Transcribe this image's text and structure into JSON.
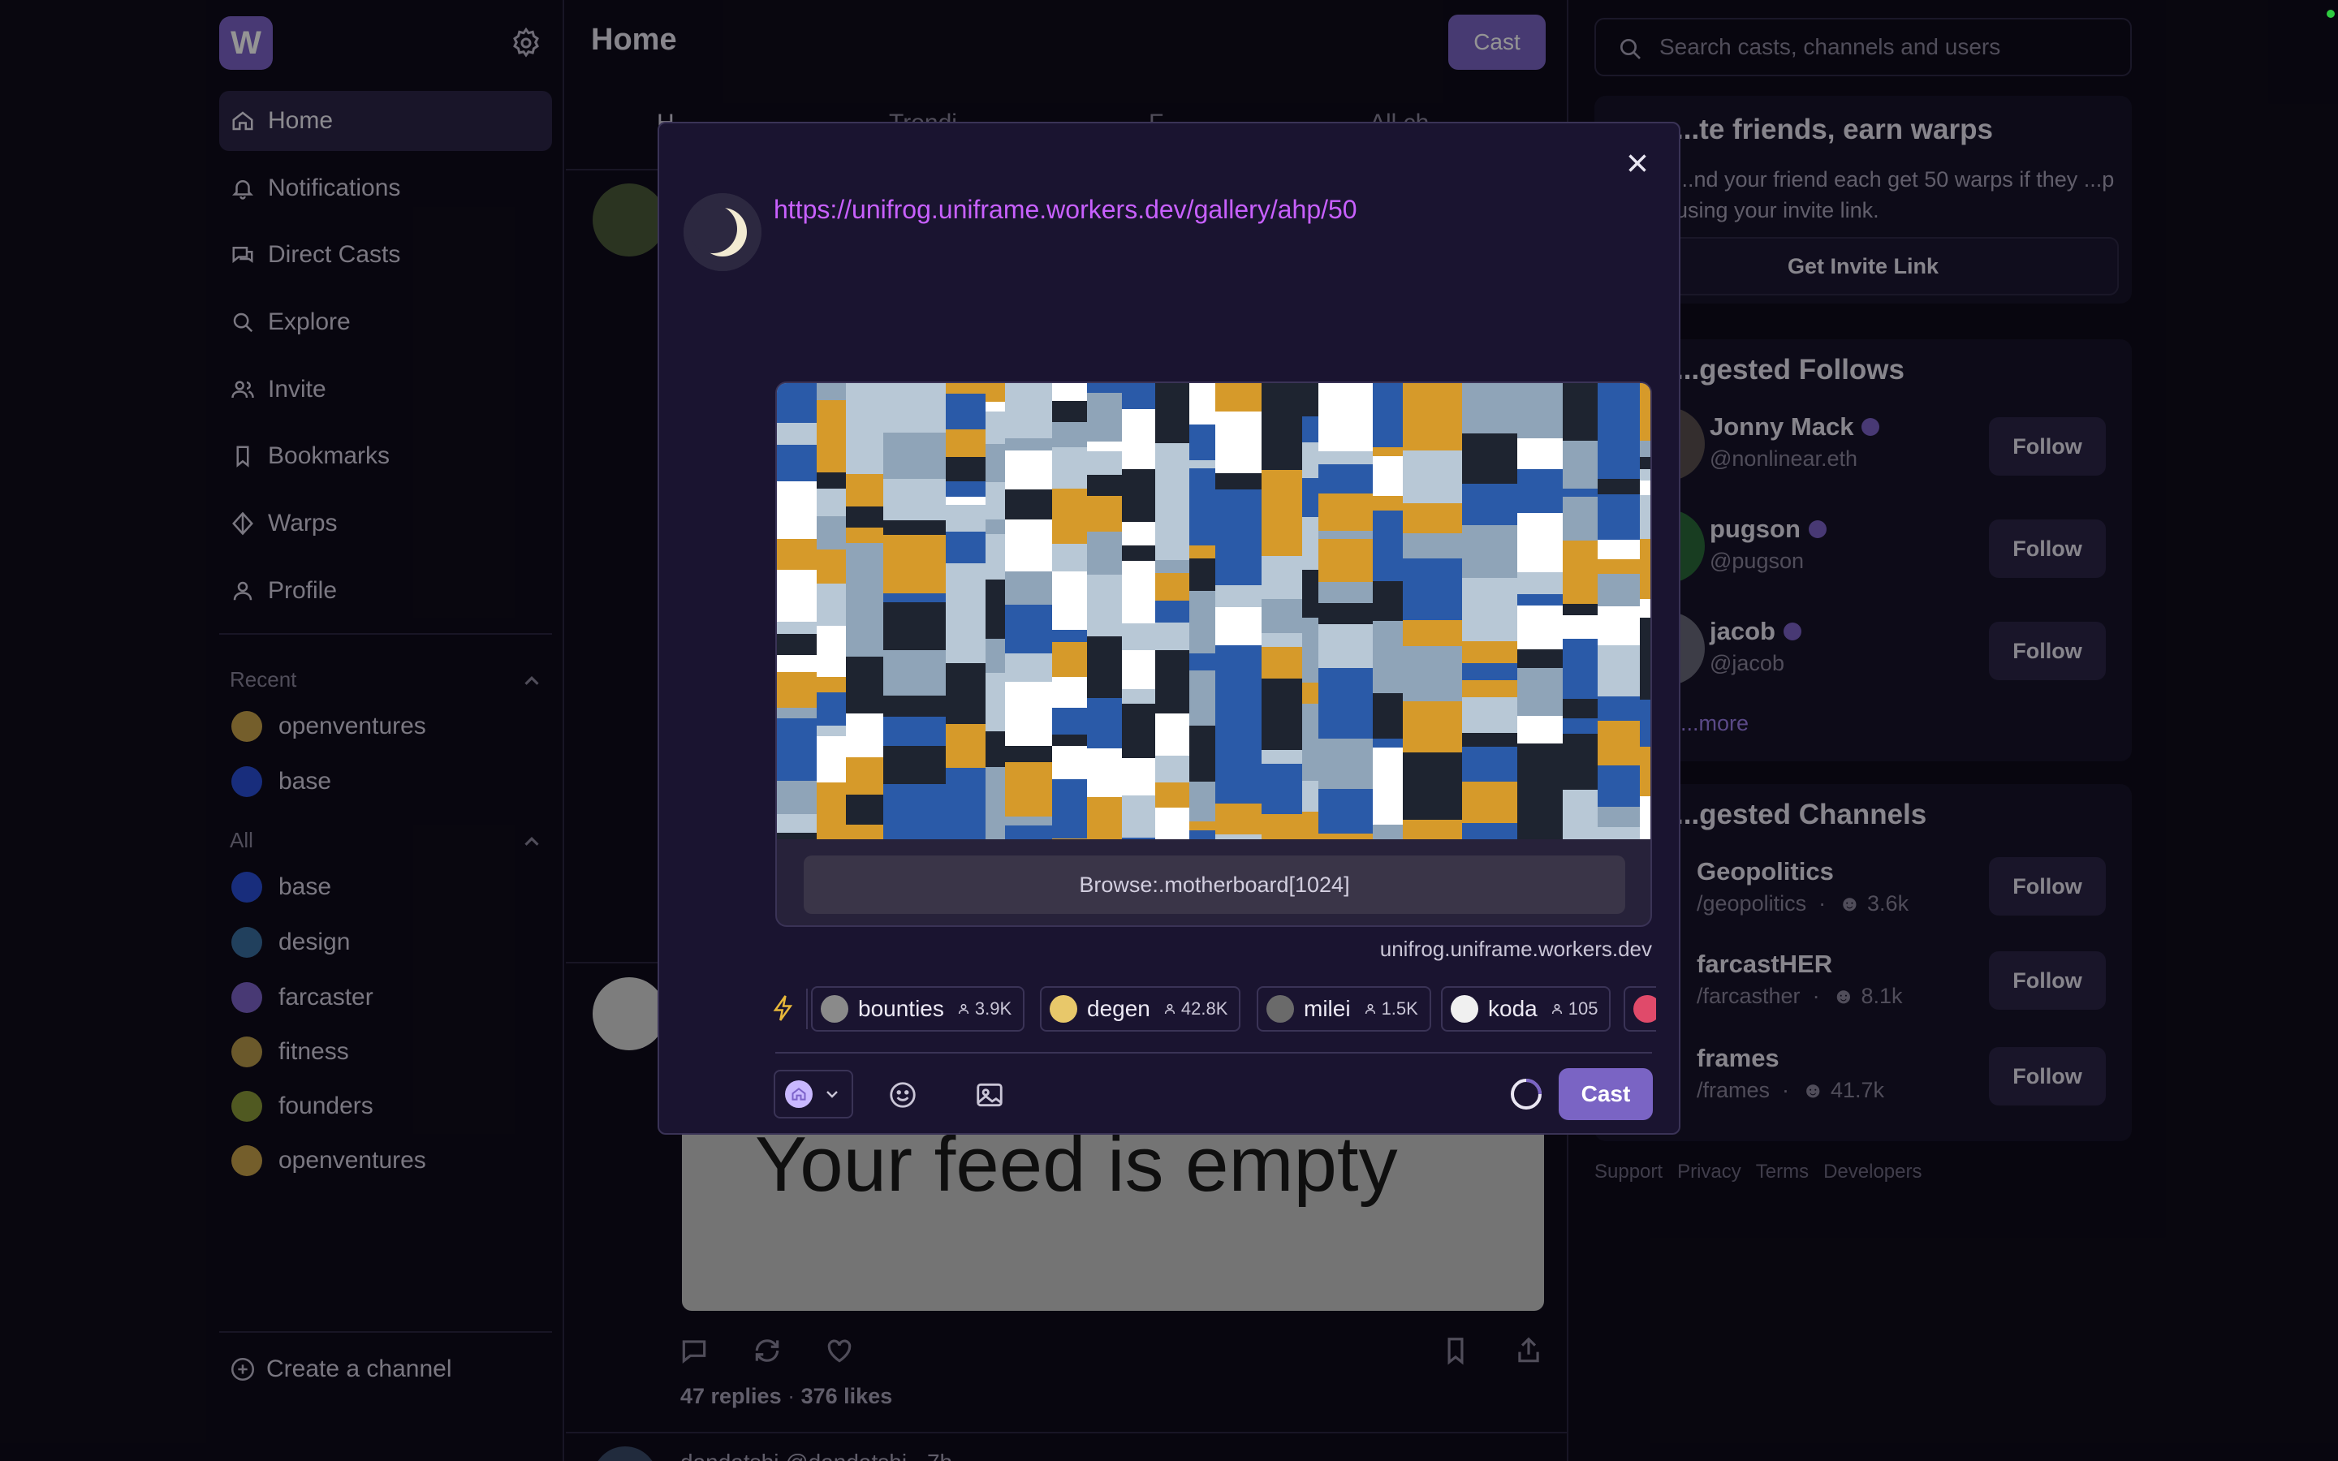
{
  "sidebar": {
    "logo": "W",
    "nav": [
      {
        "label": "Home",
        "icon": "home-icon",
        "active": true
      },
      {
        "label": "Notifications",
        "icon": "bell-icon"
      },
      {
        "label": "Direct Casts",
        "icon": "chat-icon"
      },
      {
        "label": "Explore",
        "icon": "search-icon"
      },
      {
        "label": "Invite",
        "icon": "users-icon"
      },
      {
        "label": "Bookmarks",
        "icon": "bookmark-icon"
      },
      {
        "label": "Warps",
        "icon": "diamond-icon"
      },
      {
        "label": "Profile",
        "icon": "user-icon"
      }
    ],
    "recent_label": "Recent",
    "recent": [
      {
        "label": "openventures",
        "color": "#c9a24a"
      },
      {
        "label": "base",
        "color": "#2a4ed6"
      }
    ],
    "all_label": "All",
    "all": [
      {
        "label": "base",
        "color": "#2a4ed6"
      },
      {
        "label": "design",
        "color": "#3a6ea0"
      },
      {
        "label": "farcaster",
        "color": "#7c62c9"
      },
      {
        "label": "fitness",
        "color": "#b89a4a"
      },
      {
        "label": "founders",
        "color": "#8a9a3a"
      },
      {
        "label": "openventures",
        "color": "#c9a24a"
      }
    ],
    "create_channel": "Create a channel"
  },
  "main": {
    "title": "Home",
    "cast_button": "Cast",
    "tabs": [
      "H",
      "Trendi",
      "F",
      "All ch"
    ],
    "feed_image_text": "Your feed is empty",
    "post": {
      "replies": "47 replies",
      "likes": "376 likes",
      "dot": "·"
    },
    "next_post_author": "dandatshi @dandatshi · 7h"
  },
  "right": {
    "search_placeholder": "Search casts, channels and users",
    "invite": {
      "title": "...te friends, earn warps",
      "text": "...nd your friend each get 50 warps if they ...p using your invite link.",
      "button": "Get Invite Link"
    },
    "follows_title": "...gested Follows",
    "follows": [
      {
        "name": "Jonny Mack",
        "handle": "@nonlinear.eth",
        "button": "Follow"
      },
      {
        "name": "pugson",
        "handle": "@pugson",
        "button": "Follow"
      },
      {
        "name": "jacob",
        "handle": "@jacob",
        "button": "Follow"
      }
    ],
    "show_more": "...more",
    "channels_title": "...gested Channels",
    "channels": [
      {
        "name": "Geopolitics",
        "handle": "/geopolitics",
        "members": "3.6k",
        "button": "Follow"
      },
      {
        "name": "farcastHER",
        "handle": "/farcasther",
        "members": "8.1k",
        "button": "Follow"
      },
      {
        "name": "frames",
        "handle": "/frames",
        "members": "41.7k",
        "button": "Follow"
      }
    ],
    "footer": [
      "Support",
      "Privacy",
      "Terms",
      "Developers"
    ]
  },
  "modal": {
    "url": "https://unifrog.uniframe.workers.dev/gallery/ahp/50",
    "frame_button": "Browse:.motherboard[1024]",
    "embed_domain": "unifrog.uniframe.workers.dev",
    "channel_chips": [
      {
        "name": "bounties",
        "members": "3.9K"
      },
      {
        "name": "degen",
        "members": "42.8K"
      },
      {
        "name": "milei",
        "members": "1.5K"
      },
      {
        "name": "koda",
        "members": "105"
      }
    ],
    "cast_button": "Cast",
    "frame_palette": [
      "#2a5aa8",
      "#d69a2a",
      "#b8c8d6",
      "#ffffff",
      "#1e2430",
      "#8fa4b8"
    ]
  }
}
